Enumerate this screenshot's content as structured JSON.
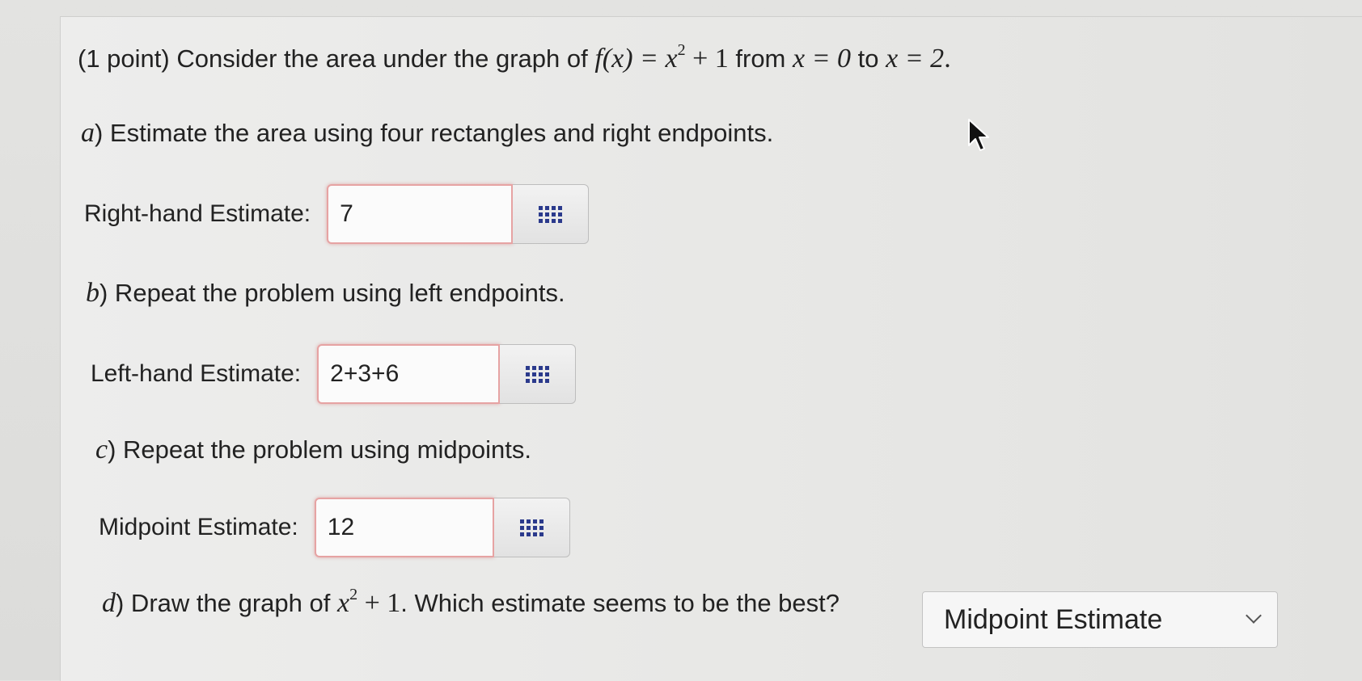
{
  "problem": {
    "intro_prefix": "(1 point) Consider the area under the graph of ",
    "intro_function": "f(x) = x",
    "intro_exp": "2",
    "intro_plus": " + 1",
    "intro_from": " from ",
    "intro_x0": "x = 0",
    "intro_to": " to ",
    "intro_x2": "x = 2",
    "intro_period": "."
  },
  "parts": {
    "a": {
      "letter": "a",
      "text": ") Estimate the area using four rectangles and right endpoints.",
      "label": "Right-hand Estimate:",
      "value": "7"
    },
    "b": {
      "letter": "b",
      "text": ") Repeat the problem using left endpoints.",
      "label": "Left-hand Estimate:",
      "value": "2+3+6"
    },
    "c": {
      "letter": "c",
      "text": ") Repeat the problem using midpoints.",
      "label": "Midpoint Estimate:",
      "value": "12"
    },
    "d": {
      "letter": "d",
      "text_before": ") Draw the graph of ",
      "math": "x",
      "exp": "2",
      "plus": " + 1",
      "text_after": ". Which estimate seems to be the best?",
      "selected": "Midpoint Estimate"
    }
  },
  "icons": {
    "keypad": "keypad-grid-icon",
    "dropdown": "chevron-down-icon",
    "cursor": "mouse-cursor-icon"
  },
  "colors": {
    "keypad_icon": "#2b3a8c",
    "invalid_border": "#e6a3a3"
  }
}
